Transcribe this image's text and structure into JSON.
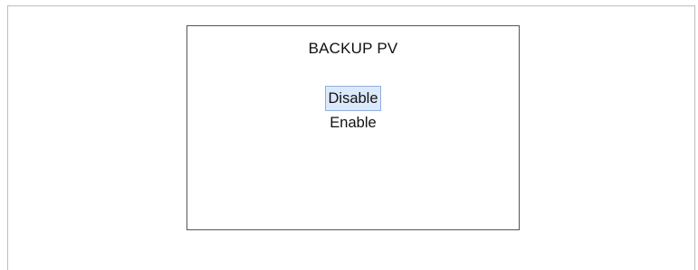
{
  "dialog": {
    "title": "BACKUP PV",
    "options": [
      {
        "label": "Disable",
        "selected": true
      },
      {
        "label": "Enable",
        "selected": false
      }
    ]
  },
  "colors": {
    "selected_bg": "#dce8fb",
    "selected_border": "#8fb0e0",
    "dialog_border": "#555555"
  }
}
